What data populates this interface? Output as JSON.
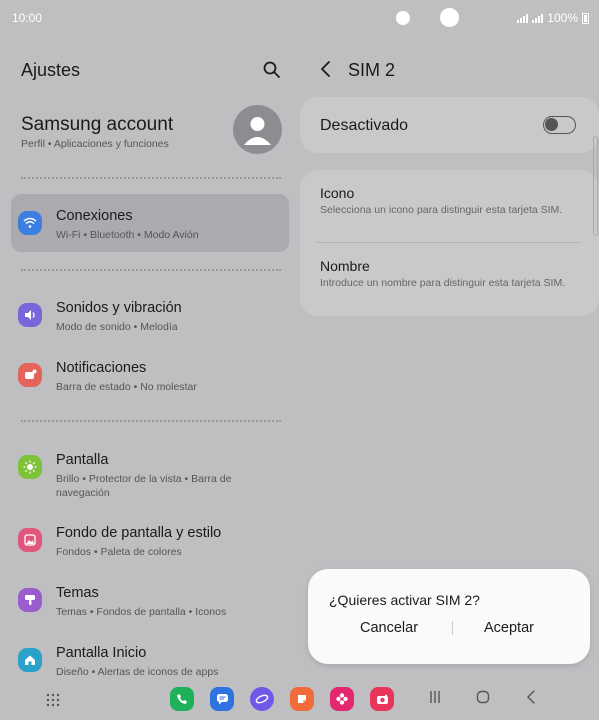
{
  "status": {
    "time": "10:00",
    "battery": "100%"
  },
  "left": {
    "title": "Ajustes",
    "account": {
      "name": "Samsung account",
      "sub": "Perfil  •  Aplicaciones y funciones"
    },
    "items": [
      {
        "label": "Conexiones",
        "sub": "Wi-Fi  •  Bluetooth  •  Modo Avión",
        "icon": "wifi-icon",
        "color": "#3d7fe0"
      },
      {
        "label": "Sonidos y vibración",
        "sub": "Modo de sonido  •  Melodía",
        "icon": "volume-icon",
        "color": "#7a66d9"
      },
      {
        "label": "Notificaciones",
        "sub": "Barra de estado  •  No molestar",
        "icon": "notification-icon",
        "color": "#e4645c"
      },
      {
        "label": "Pantalla",
        "sub": "Brillo  •  Protector de la vista  •  Barra de navegación",
        "icon": "brightness-icon",
        "color": "#7fc23a"
      },
      {
        "label": "Fondo de pantalla y estilo",
        "sub": "Fondos  •  Paleta de colores",
        "icon": "wallpaper-icon",
        "color": "#e0577e"
      },
      {
        "label": "Temas",
        "sub": "Temas  •  Fondos de pantalla  •  Iconos",
        "icon": "themes-icon",
        "color": "#9b5ccd"
      },
      {
        "label": "Pantalla Inicio",
        "sub": "Diseño  •  Alertas de iconos de apps",
        "icon": "home-icon",
        "color": "#2aa1c9"
      }
    ]
  },
  "right": {
    "title": "SIM 2",
    "toggle": {
      "label": "Desactivado",
      "on": false
    },
    "rows": [
      {
        "label": "Icono",
        "sub": "Selecciona un icono para distinguir esta tarjeta SIM."
      },
      {
        "label": "Nombre",
        "sub": "Introduce un nombre para distinguir esta tarjeta SIM."
      }
    ]
  },
  "dialog": {
    "message": "¿Quieres activar SIM 2?",
    "cancel": "Cancelar",
    "accept": "Aceptar"
  },
  "dock": [
    {
      "icon": "phone-icon",
      "color": "#1fb15a"
    },
    {
      "icon": "messages-icon",
      "color": "#2f73e0"
    },
    {
      "icon": "browser-icon",
      "color": "#6e58e8"
    },
    {
      "icon": "notes-icon",
      "color": "#f26b3a"
    },
    {
      "icon": "gallery-icon",
      "color": "#e3286f"
    },
    {
      "icon": "camera-icon",
      "color": "#e8365a"
    }
  ]
}
